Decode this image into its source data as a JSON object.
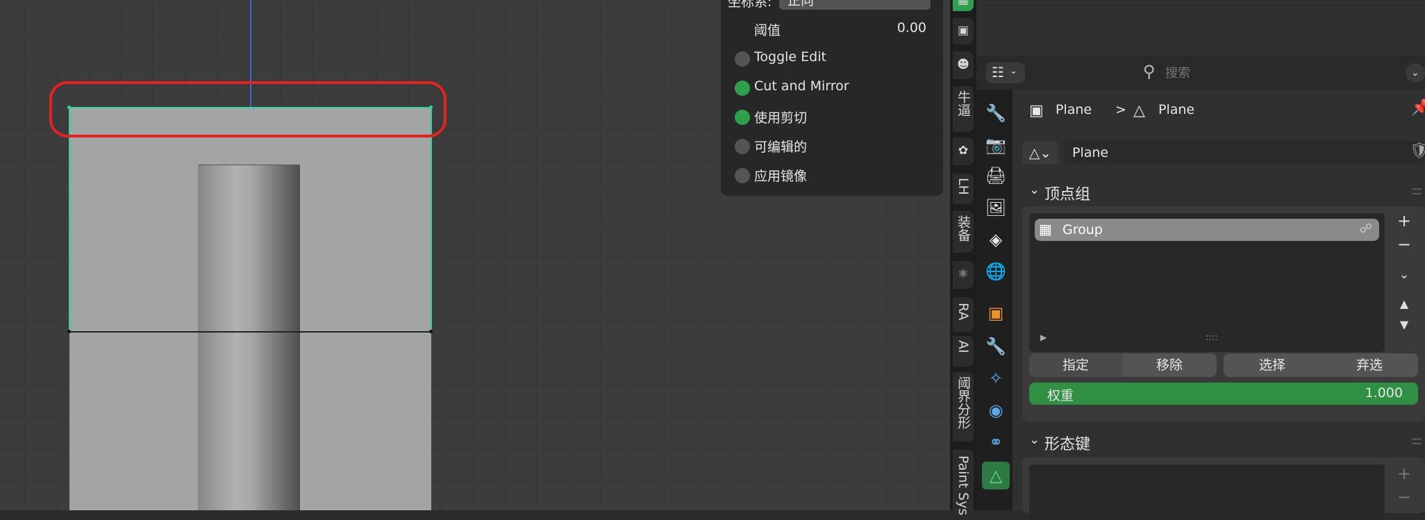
{
  "viewport": {
    "operator_panel": {
      "coord_label": "坐标系:",
      "coord_value": "正向",
      "threshold_label": "阈值",
      "threshold_value": "0.00",
      "options": [
        {
          "label": "Toggle Edit",
          "checked": false
        },
        {
          "label": "Cut and Mirror",
          "checked": true
        },
        {
          "label": "使用剪切",
          "checked": true
        },
        {
          "label": "可编辑的",
          "checked": false
        },
        {
          "label": "应用镜像",
          "checked": false
        }
      ]
    },
    "highlight_color": "#e5221e"
  },
  "side_tabs": [
    "牛逼",
    "LH",
    "装备",
    "RA",
    "AI",
    "阈界分形",
    "Paint Sys"
  ],
  "side_tab_icons": [
    "grid-icon",
    "cube-icon",
    "user-icon",
    "chip-icon",
    "leaf-icon",
    "atom-icon"
  ],
  "properties": {
    "search_placeholder": "搜索",
    "breadcrumb": {
      "object": "Plane",
      "separator": ">",
      "mesh": "Plane"
    },
    "data_name": "Plane",
    "vertex_groups": {
      "title": "顶点组",
      "items": [
        {
          "name": "Group"
        }
      ],
      "buttons": {
        "assign": "指定",
        "remove": "移除",
        "select": "选择",
        "deselect": "弃选"
      },
      "weight_label": "权重",
      "weight_value": "1.000"
    },
    "shape_keys": {
      "title": "形态键"
    },
    "accent_green": "#2ea04d"
  }
}
